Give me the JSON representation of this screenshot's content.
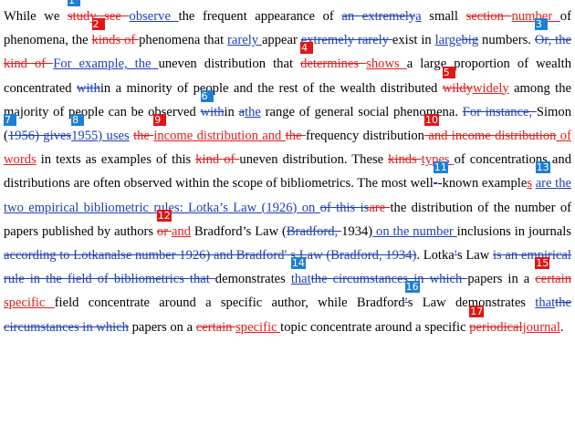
{
  "colors": {
    "red": "#e01616",
    "blue": "#1e7fd4",
    "text": "#000000"
  },
  "segments": [
    {
      "t": "n",
      "s": "While we "
    },
    {
      "t": "badge",
      "n": "1",
      "c": "blue"
    },
    {
      "t": "dr",
      "s": "study "
    },
    {
      "t": "dr",
      "s": "see "
    },
    {
      "t": "ib",
      "s": "observe "
    },
    {
      "t": "n",
      "s": "the frequent appearance of "
    },
    {
      "t": "db",
      "s": "an extremely"
    },
    {
      "t": "ib",
      "s": "a"
    },
    {
      "t": "n",
      "s": " small "
    },
    {
      "t": "dr",
      "s": "section "
    },
    {
      "t": "ir",
      "s": "number "
    },
    {
      "t": "n",
      "s": "of phenomena, the "
    },
    {
      "t": "badge",
      "n": "2",
      "c": "red"
    },
    {
      "t": "dr",
      "s": "kinds of "
    },
    {
      "t": "n",
      "s": "phenomena that "
    },
    {
      "t": "ib",
      "s": " rarely "
    },
    {
      "t": "n",
      "s": " appear "
    },
    {
      "t": "db",
      "s": "extremely rarely "
    },
    {
      "t": "n",
      "s": "exist in "
    },
    {
      "t": "ib",
      "s": "large"
    },
    {
      "t": "db",
      "s": "big"
    },
    {
      "t": "n",
      "s": " numbers. "
    },
    {
      "t": "badge",
      "n": "3",
      "c": "blue"
    },
    {
      "t": "db",
      "s": "Or, the "
    },
    {
      "t": "dr",
      "s": "kind of "
    },
    {
      "t": "ib",
      "s": "For example, the "
    },
    {
      "t": "n",
      "s": "uneven distribution that "
    },
    {
      "t": "badge",
      "n": "4",
      "c": "red"
    },
    {
      "t": "dr",
      "s": "determines "
    },
    {
      "t": "ir",
      "s": "shows "
    },
    {
      "t": "n",
      "s": "a large proportion of wealth concentrated "
    },
    {
      "t": "db",
      "s": "with"
    },
    {
      "t": "n",
      "s": "in a minority of people and the rest of the wealth distributed "
    },
    {
      "t": "badge",
      "n": "5",
      "c": "red"
    },
    {
      "t": "dr",
      "s": "wildy"
    },
    {
      "t": "ir",
      "s": "widely"
    },
    {
      "t": "n",
      "s": " among the majority of people can be observed "
    },
    {
      "t": "badge",
      "n": "6",
      "c": "blue"
    },
    {
      "t": "db",
      "s": "with"
    },
    {
      "t": "n",
      "s": "in "
    },
    {
      "t": "db",
      "s": "a"
    },
    {
      "t": "ib",
      "s": "the"
    },
    {
      "t": "n",
      "s": " range of general social phenomena. "
    },
    {
      "t": "db",
      "s": "For instance, "
    },
    {
      "t": "n",
      "s": "Simon "
    },
    {
      "t": "badge",
      "n": "7",
      "c": "blue"
    },
    {
      "t": "n",
      "s": "("
    },
    {
      "t": "db",
      "s": "1956) gives"
    },
    {
      "t": "badge",
      "n": "8",
      "c": "blue"
    },
    {
      "t": "ib",
      "s": "1955) uses"
    },
    {
      "t": "n",
      "s": " "
    },
    {
      "t": "dr",
      "s": "the "
    },
    {
      "t": "badge",
      "n": "9",
      "c": "red"
    },
    {
      "t": "ir",
      "s": "income distribution and "
    },
    {
      "t": "dr",
      "s": "the "
    },
    {
      "t": "n",
      "s": "frequency distribution"
    },
    {
      "t": "badge",
      "n": "10",
      "c": "red"
    },
    {
      "t": "dr",
      "s": " and income distribution"
    },
    {
      "t": "ir",
      "s": " of words"
    },
    {
      "t": "n",
      "s": " in texts as examples of this "
    },
    {
      "t": "dr",
      "s": "kind of "
    },
    {
      "t": "n",
      "s": "uneven distribution. These "
    },
    {
      "t": "dr",
      "s": "kinds "
    },
    {
      "t": "ir",
      "s": "types "
    },
    {
      "t": "n",
      "s": "of concentrations and distributions are often observed within the scope of bibliometrics. The most "
    },
    {
      "t": "n",
      "s": "well"
    },
    {
      "t": "badge",
      "n": "11",
      "c": "blue"
    },
    {
      "t": "db",
      "s": "-"
    },
    {
      "t": "n",
      "s": "-known example"
    },
    {
      "t": "ir",
      "s": "s"
    },
    {
      "t": "n",
      "s": " "
    },
    {
      "t": "badge",
      "n": "13",
      "c": "blue"
    },
    {
      "t": "ib",
      "s": "are the two empirical bibliometric rules: Lotka’s Law (1926) on "
    },
    {
      "t": "db",
      "s": "of this is"
    },
    {
      "t": "dr",
      "s": "are "
    },
    {
      "t": "n",
      "s": "the distribution of the number of papers published by authors "
    },
    {
      "t": "badge",
      "n": "12",
      "c": "red"
    },
    {
      "t": "dr",
      "s": "or "
    },
    {
      "t": "ir",
      "s": "and"
    },
    {
      "t": "n",
      "s": " Bradford’s Law ("
    },
    {
      "t": "db",
      "s": "Bradford, "
    },
    {
      "t": "n",
      "s": "1934)"
    },
    {
      "t": "ib",
      "s": " on the number "
    },
    {
      "t": "n",
      "s": "inclusions in journals"
    },
    {
      "t": "db",
      "s": " according to Lotkanalse number   1926) and Bradford′ s Law (Bradford, 1934)"
    },
    {
      "t": "n",
      "s": ". Lotka"
    },
    {
      "t": "db",
      "s": "′"
    },
    {
      "t": "n",
      "s": "s Law "
    },
    {
      "t": "db",
      "s": "is an empirical rule in the field of bibliometrics that "
    },
    {
      "t": "n",
      "s": "demonstrates "
    },
    {
      "t": "badge",
      "n": "14",
      "c": "blue"
    },
    {
      "t": "ib",
      "s": "that"
    },
    {
      "t": "db",
      "s": "the circumstances in which "
    },
    {
      "t": "n",
      "s": " papers in a "
    },
    {
      "t": "badge",
      "n": "15",
      "c": "red"
    },
    {
      "t": "dr",
      "s": "certain "
    },
    {
      "t": "ir",
      "s": "specific "
    },
    {
      "t": "n",
      "s": "field concentrate around a specific author, while Bradford"
    },
    {
      "t": "badge",
      "n": "16",
      "c": "blue"
    },
    {
      "t": "db",
      "s": "′"
    },
    {
      "t": "n",
      "s": "s Law demonstrates "
    },
    {
      "t": "ib",
      "s": "that"
    },
    {
      "t": "db",
      "s": "the circumstances in which"
    },
    {
      "t": "n",
      "s": " papers on a "
    },
    {
      "t": "dr",
      "s": "certain "
    },
    {
      "t": "ir",
      "s": "specific "
    },
    {
      "t": "n",
      "s": "topic concentrate around a specific "
    },
    {
      "t": "badge",
      "n": "17",
      "c": "red"
    },
    {
      "t": "dr",
      "s": "periodical"
    },
    {
      "t": "ir",
      "s": "journal"
    },
    {
      "t": "n",
      "s": "."
    }
  ]
}
